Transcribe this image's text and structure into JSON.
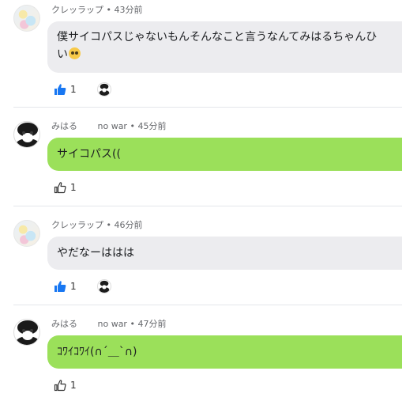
{
  "comments": [
    {
      "author": "クレッラップ",
      "time": "43分前",
      "text_line1": "僕サイコパスじゃないもんそんなこと言うなんてみはるちゃんひ",
      "text_line2": "い",
      "emoji_icon": "pleading-face-emoji",
      "likes": "1",
      "liked": true,
      "has_creator_heart": true
    },
    {
      "author": "みはる",
      "tag": "no war",
      "time": "45分前",
      "text": "サイコパス((",
      "likes": "1",
      "liked": false
    },
    {
      "author": "クレッラップ",
      "time": "46分前",
      "text": "やだなーははは",
      "likes": "1",
      "liked": true,
      "has_creator_heart": true
    },
    {
      "author": "みはる",
      "tag": "no war",
      "time": "47分前",
      "text": "ｺﾜｲｺﾜｲ(∩´＿`∩)",
      "likes": "1",
      "liked": false
    }
  ],
  "separator": "•",
  "colors": {
    "liked_blue": "#1877f2",
    "own_bubble": "#9be05a",
    "other_bubble": "#ececef"
  }
}
